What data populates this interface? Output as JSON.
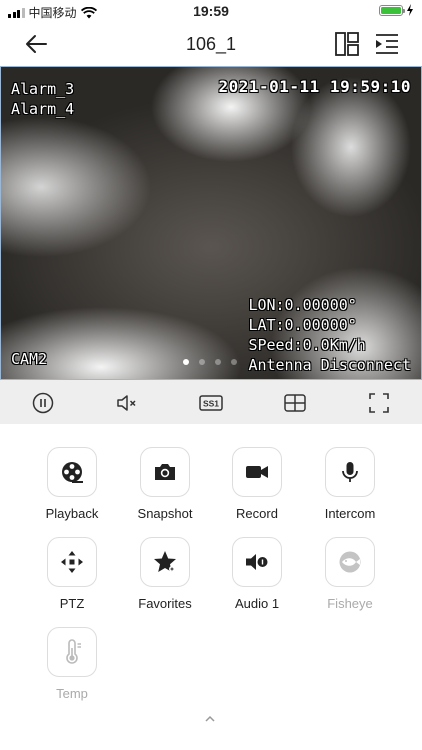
{
  "status_bar": {
    "carrier": "中国移动",
    "time": "19:59",
    "icons": [
      "signal-icon",
      "wifi-icon",
      "battery-icon",
      "charging-icon"
    ],
    "battery_color": "#3cc13b"
  },
  "nav": {
    "title": "106_1",
    "icons": [
      "back-arrow-icon",
      "split-view-icon",
      "channel-list-icon"
    ]
  },
  "video": {
    "alarm_1": "Alarm_3",
    "alarm_2": "Alarm_4",
    "datetime": "2021-01-11  19:59:10",
    "lon": "LON:0.00000°",
    "lat": "LAT:0.00000°",
    "speed": "SPeed:0.0Km/h",
    "antenna": "Antenna Disconnect",
    "camera": "CAM2",
    "page_dots": 4,
    "active_dot": 0
  },
  "controls": {
    "icons": [
      "pause-icon",
      "mute-icon",
      "stream-ss1-icon",
      "grid-layout-icon",
      "fullscreen-icon"
    ],
    "stream_label": "SS1"
  },
  "functions": [
    {
      "label": "Playback",
      "icon": "film-reel-icon",
      "enabled": true
    },
    {
      "label": "Snapshot",
      "icon": "camera-icon",
      "enabled": true
    },
    {
      "label": "Record",
      "icon": "video-camera-icon",
      "enabled": true
    },
    {
      "label": "Intercom",
      "icon": "microphone-icon",
      "enabled": true
    },
    {
      "label": "PTZ",
      "icon": "ptz-arrows-icon",
      "enabled": true
    },
    {
      "label": "Favorites",
      "icon": "star-icon",
      "enabled": true
    },
    {
      "label": "Audio 1",
      "icon": "speaker-icon",
      "enabled": true
    },
    {
      "label": "Fisheye",
      "icon": "fisheye-icon",
      "enabled": false
    },
    {
      "label": "Temp",
      "icon": "thermometer-icon",
      "enabled": false
    }
  ],
  "colors": {
    "control_bar_bg": "#eeeeee",
    "disabled_text": "#aaaaaa",
    "icon_dark": "#222222"
  }
}
